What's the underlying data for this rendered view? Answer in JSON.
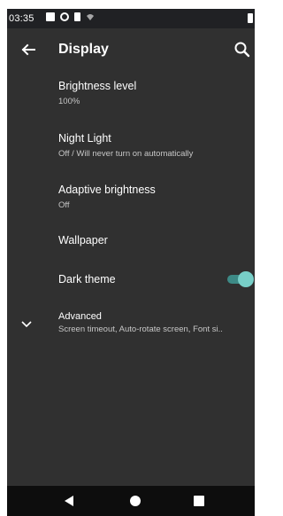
{
  "status_bar": {
    "time": "03:35"
  },
  "header": {
    "title": "Display"
  },
  "settings": {
    "brightness": {
      "title": "Brightness level",
      "summary": "100%"
    },
    "night_light": {
      "title": "Night Light",
      "summary": "Off / Will never turn on automatically"
    },
    "adaptive": {
      "title": "Adaptive brightness",
      "summary": "Off"
    },
    "wallpaper": {
      "title": "Wallpaper"
    },
    "dark_theme": {
      "title": "Dark theme",
      "enabled": true
    },
    "advanced": {
      "title": "Advanced",
      "summary": "Screen timeout, Auto-rotate screen, Font si.."
    }
  },
  "colors": {
    "background": "#303030",
    "accent": "#78cfc8",
    "nav_bar": "#0d0d0d"
  },
  "icons": {
    "back": "arrow-left",
    "search": "magnifier",
    "advanced": "chevron-down",
    "nav": [
      "triangle-back",
      "circle-home",
      "square-recents"
    ]
  }
}
